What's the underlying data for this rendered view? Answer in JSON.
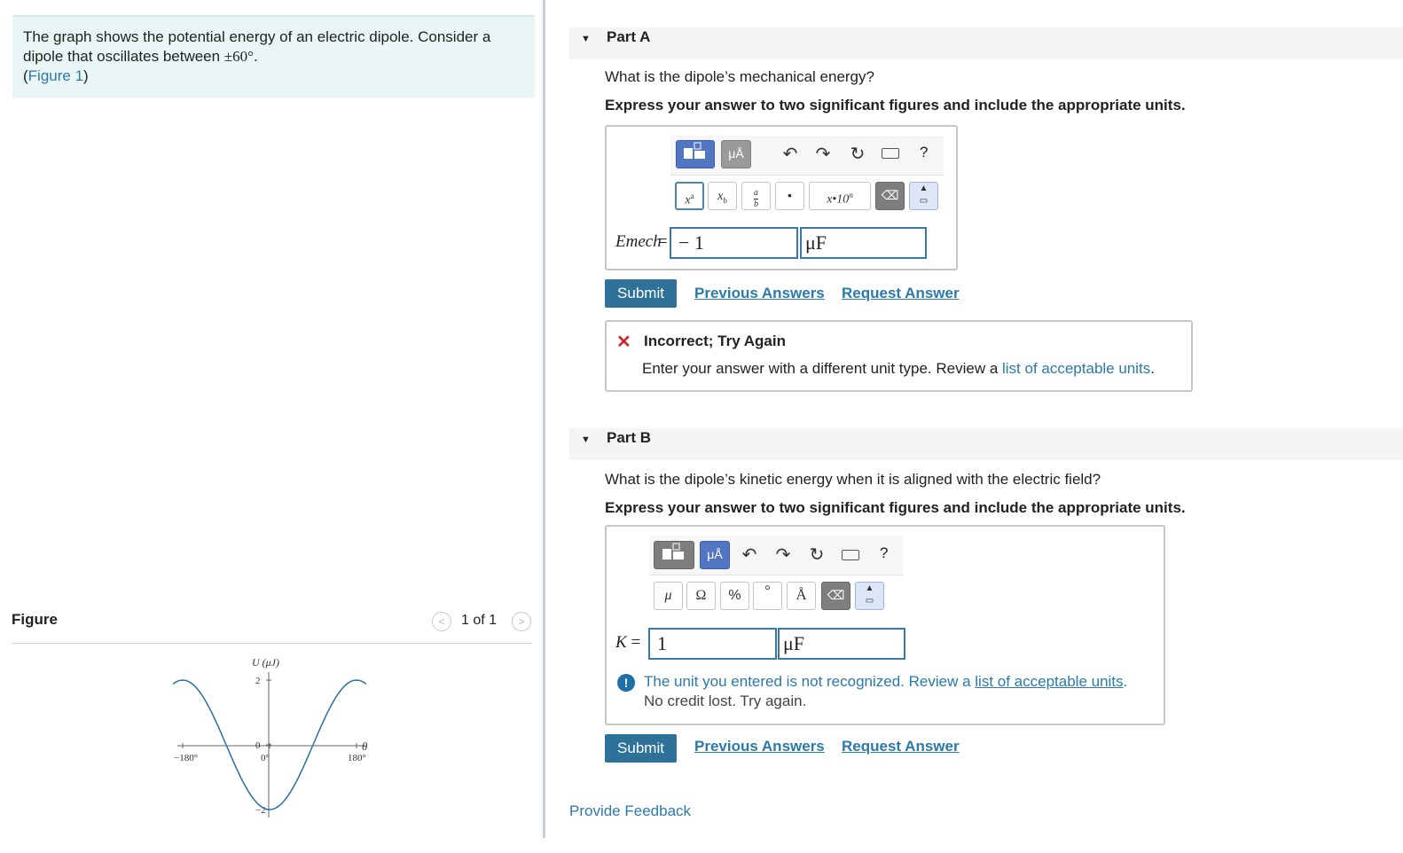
{
  "intro": {
    "text_line1": "The graph shows the potential energy of an electric dipole. Consider a",
    "text_line2_prefix": "dipole that oscillates between ",
    "angle": "±60°",
    "text_line2_suffix": ".",
    "figure_ref_open": "(",
    "figure_link": "Figure 1",
    "figure_ref_close": ")"
  },
  "figure": {
    "label": "Figure",
    "pager": {
      "prev_icon": "chevron-left-icon",
      "next_icon": "chevron-right-icon",
      "count": "1 of 1"
    }
  },
  "chart_data": {
    "type": "line",
    "ylabel": "U (μJ)",
    "xlabel": "θ",
    "x_ticks": [
      "−180°",
      "0°",
      "180°"
    ],
    "y_ticks": [
      "2",
      "0",
      "−2"
    ],
    "xlim": [
      -180,
      180
    ],
    "ylim": [
      -2,
      2
    ],
    "series": [
      {
        "x": [
          -180,
          -135,
          -90,
          -45,
          0,
          45,
          90,
          135,
          180
        ],
        "y": [
          2,
          1.41,
          0,
          -1.41,
          -2,
          -1.41,
          0,
          1.41,
          2
        ]
      }
    ]
  },
  "partA": {
    "title": "Part A",
    "question": "What is the dipole’s mechanical energy?",
    "instruction": "Express your answer to two significant figures and include the appropriate units.",
    "toolbar": {
      "mu_a": "μÅ",
      "help": "?"
    },
    "math_buttons": {
      "superscript": "x",
      "superscript_exp": "a",
      "subscript": "x",
      "subscript_sub": "b",
      "fraction_num": "a",
      "fraction_den": "b",
      "dot": "•",
      "sci": "x•10",
      "sci_exp": "n"
    },
    "input_label": "Emech",
    "input_label_suffix": "=",
    "value": "− 1",
    "unit": "μF",
    "submit": "Submit",
    "previous_answers": "Previous Answers",
    "request_answer": "Request Answer",
    "feedback": {
      "title": "Incorrect; Try Again",
      "message_prefix": "Enter your answer with a different unit type. Review a ",
      "message_link": "list of acceptable units",
      "message_suffix": "."
    }
  },
  "partB": {
    "title": "Part B",
    "question": "What is the dipole’s kinetic energy when it is aligned with the electric field?",
    "instruction": "Express your answer to two significant figures and include the appropriate units.",
    "toolbar": {
      "mu_a": "μÅ",
      "help": "?"
    },
    "unit_buttons": {
      "mu": "μ",
      "omega": "Ω",
      "percent": "%",
      "degree": "°",
      "angstrom": "Å"
    },
    "input_label": "K",
    "input_label_suffix": "=",
    "value": "1",
    "unit": "μF",
    "warning_prefix": "The unit you entered is not recognized. Review a ",
    "warning_link": "list of acceptable units",
    "warning_suffix": ".",
    "warning_line2": "No credit lost. Try again.",
    "submit": "Submit",
    "previous_answers": "Previous Answers",
    "request_answer": "Request Answer"
  },
  "provide_feedback": "Provide Feedback"
}
